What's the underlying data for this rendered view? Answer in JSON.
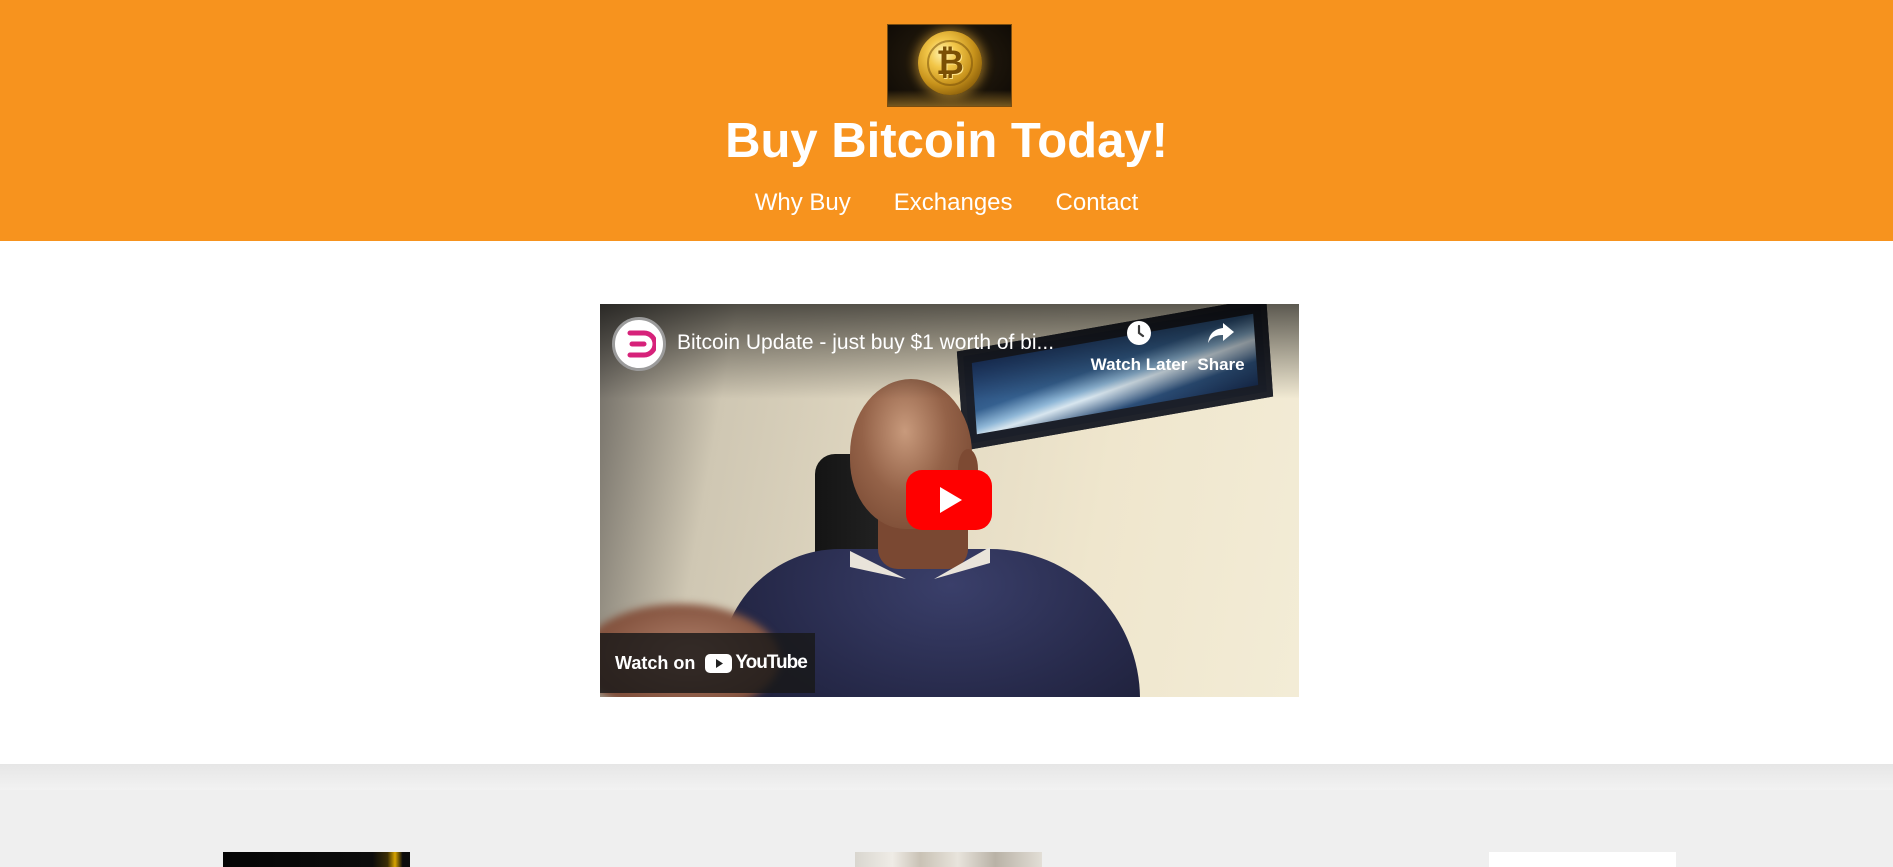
{
  "header": {
    "site_title": "Buy Bitcoin Today!",
    "nav": [
      {
        "label": "Why Buy"
      },
      {
        "label": "Exchanges"
      },
      {
        "label": "Contact"
      }
    ],
    "background_color": "#f7931e"
  },
  "video": {
    "title": "Bitcoin Update - just buy $1 worth of bi...",
    "watch_later_label": "Watch Later",
    "share_label": "Share",
    "watch_on_label": "Watch on",
    "platform_label": "YouTube",
    "icons": [
      "clock-icon",
      "share-arrow-icon",
      "play-icon",
      "youtube-logo-icon"
    ]
  },
  "colors": {
    "accent": "#f7931e",
    "play_red": "#ff0000",
    "lower_section_bg": "#efefef"
  }
}
